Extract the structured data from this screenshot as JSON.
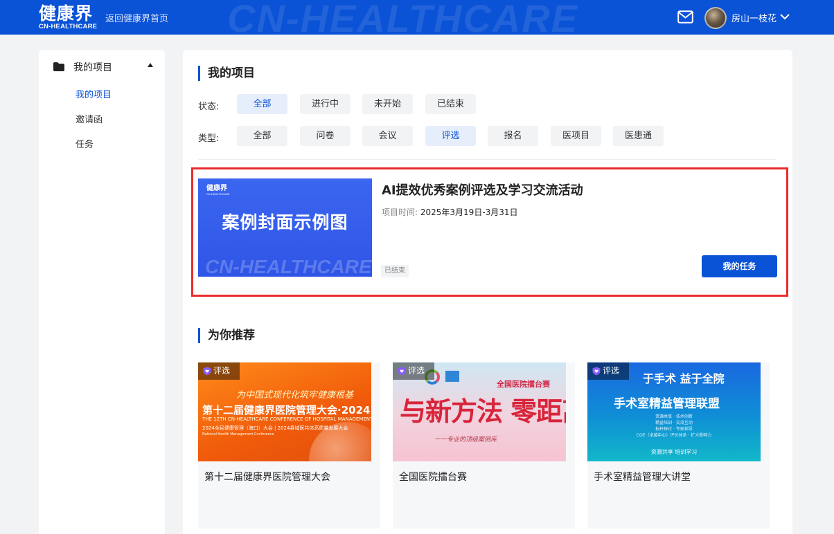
{
  "header": {
    "logo_cn": "健康界",
    "logo_en": "CN-HEALTHCARE",
    "back_link": "返回健康界首页",
    "watermark": "CN-HEALTHCARE",
    "username": "房山一枝花",
    "icons": [
      "mail-icon",
      "avatar",
      "chevron-down-icon"
    ]
  },
  "sidebar": {
    "heading": "我的项目",
    "items": [
      {
        "label": "我的项目",
        "active": true
      },
      {
        "label": "邀请函",
        "active": false
      },
      {
        "label": "任务",
        "active": false
      }
    ]
  },
  "my_projects": {
    "title": "我的项目",
    "status_label": "状态:",
    "status_options": [
      {
        "label": "全部",
        "active": true
      },
      {
        "label": "进行中",
        "active": false
      },
      {
        "label": "未开始",
        "active": false
      },
      {
        "label": "已结束",
        "active": false
      }
    ],
    "type_label": "类型:",
    "type_options": [
      {
        "label": "全部",
        "active": false
      },
      {
        "label": "问卷",
        "active": false
      },
      {
        "label": "会议",
        "active": false
      },
      {
        "label": "评选",
        "active": true
      },
      {
        "label": "报名",
        "active": false
      },
      {
        "label": "医项目",
        "active": false
      },
      {
        "label": "医患通",
        "active": false
      }
    ],
    "project": {
      "cover_logo_cn": "健康界",
      "cover_logo_en": "CN-HEALTHCARE",
      "cover_text": "案例封面示例图",
      "cover_watermark": "CN-HEALTHCARE",
      "title": "AI提效优秀案例评选及学习交流活动",
      "time_label": "项目时间:",
      "time_value": "2025年3月19日-3月31日",
      "status": "已结束",
      "button": "我的任务"
    }
  },
  "recommend": {
    "title": "为你推荐",
    "cards": [
      {
        "badge": "评选",
        "title": "第十二届健康界医院管理大会",
        "img_l1": "为中国式现代化筑牢健康根基",
        "img_l2": "第十二届健康界医院管理大会·2024",
        "img_l3": "THE 12TH CN-HEALTHCARE CONFERENCE OF HOSPITAL MANAGEMENT",
        "img_l4": "2024全民健康管理（海口）大会 | 2024县域医共体高质量发展大会",
        "img_l5": "National Health Management Conference"
      },
      {
        "badge": "评选",
        "title": "全国医院擂台赛",
        "img_h1": "全国医院擂台赛",
        "img_h2": "与新方法 零距离",
        "img_h3": "一一专业的顶级案例库"
      },
      {
        "badge": "评选",
        "title": "手术室精益管理大讲堂",
        "img_t1": "于手术 益于全院",
        "img_t2": "手术室精益管理联盟",
        "img_t3": "资源共享 · 技术创新\n精益培训 · 交流互动\n标杆探讨 · 专家指导\nCOE（卓越中心）评价体系 · 扩大影响力",
        "img_t4": "资源共享    培训学习"
      }
    ]
  },
  "colors": {
    "brand": "#0a52d6",
    "highlight_border": "#ea2b2b",
    "chip_bg": "#f2f3f5",
    "chip_active_bg": "#e6eefc"
  }
}
